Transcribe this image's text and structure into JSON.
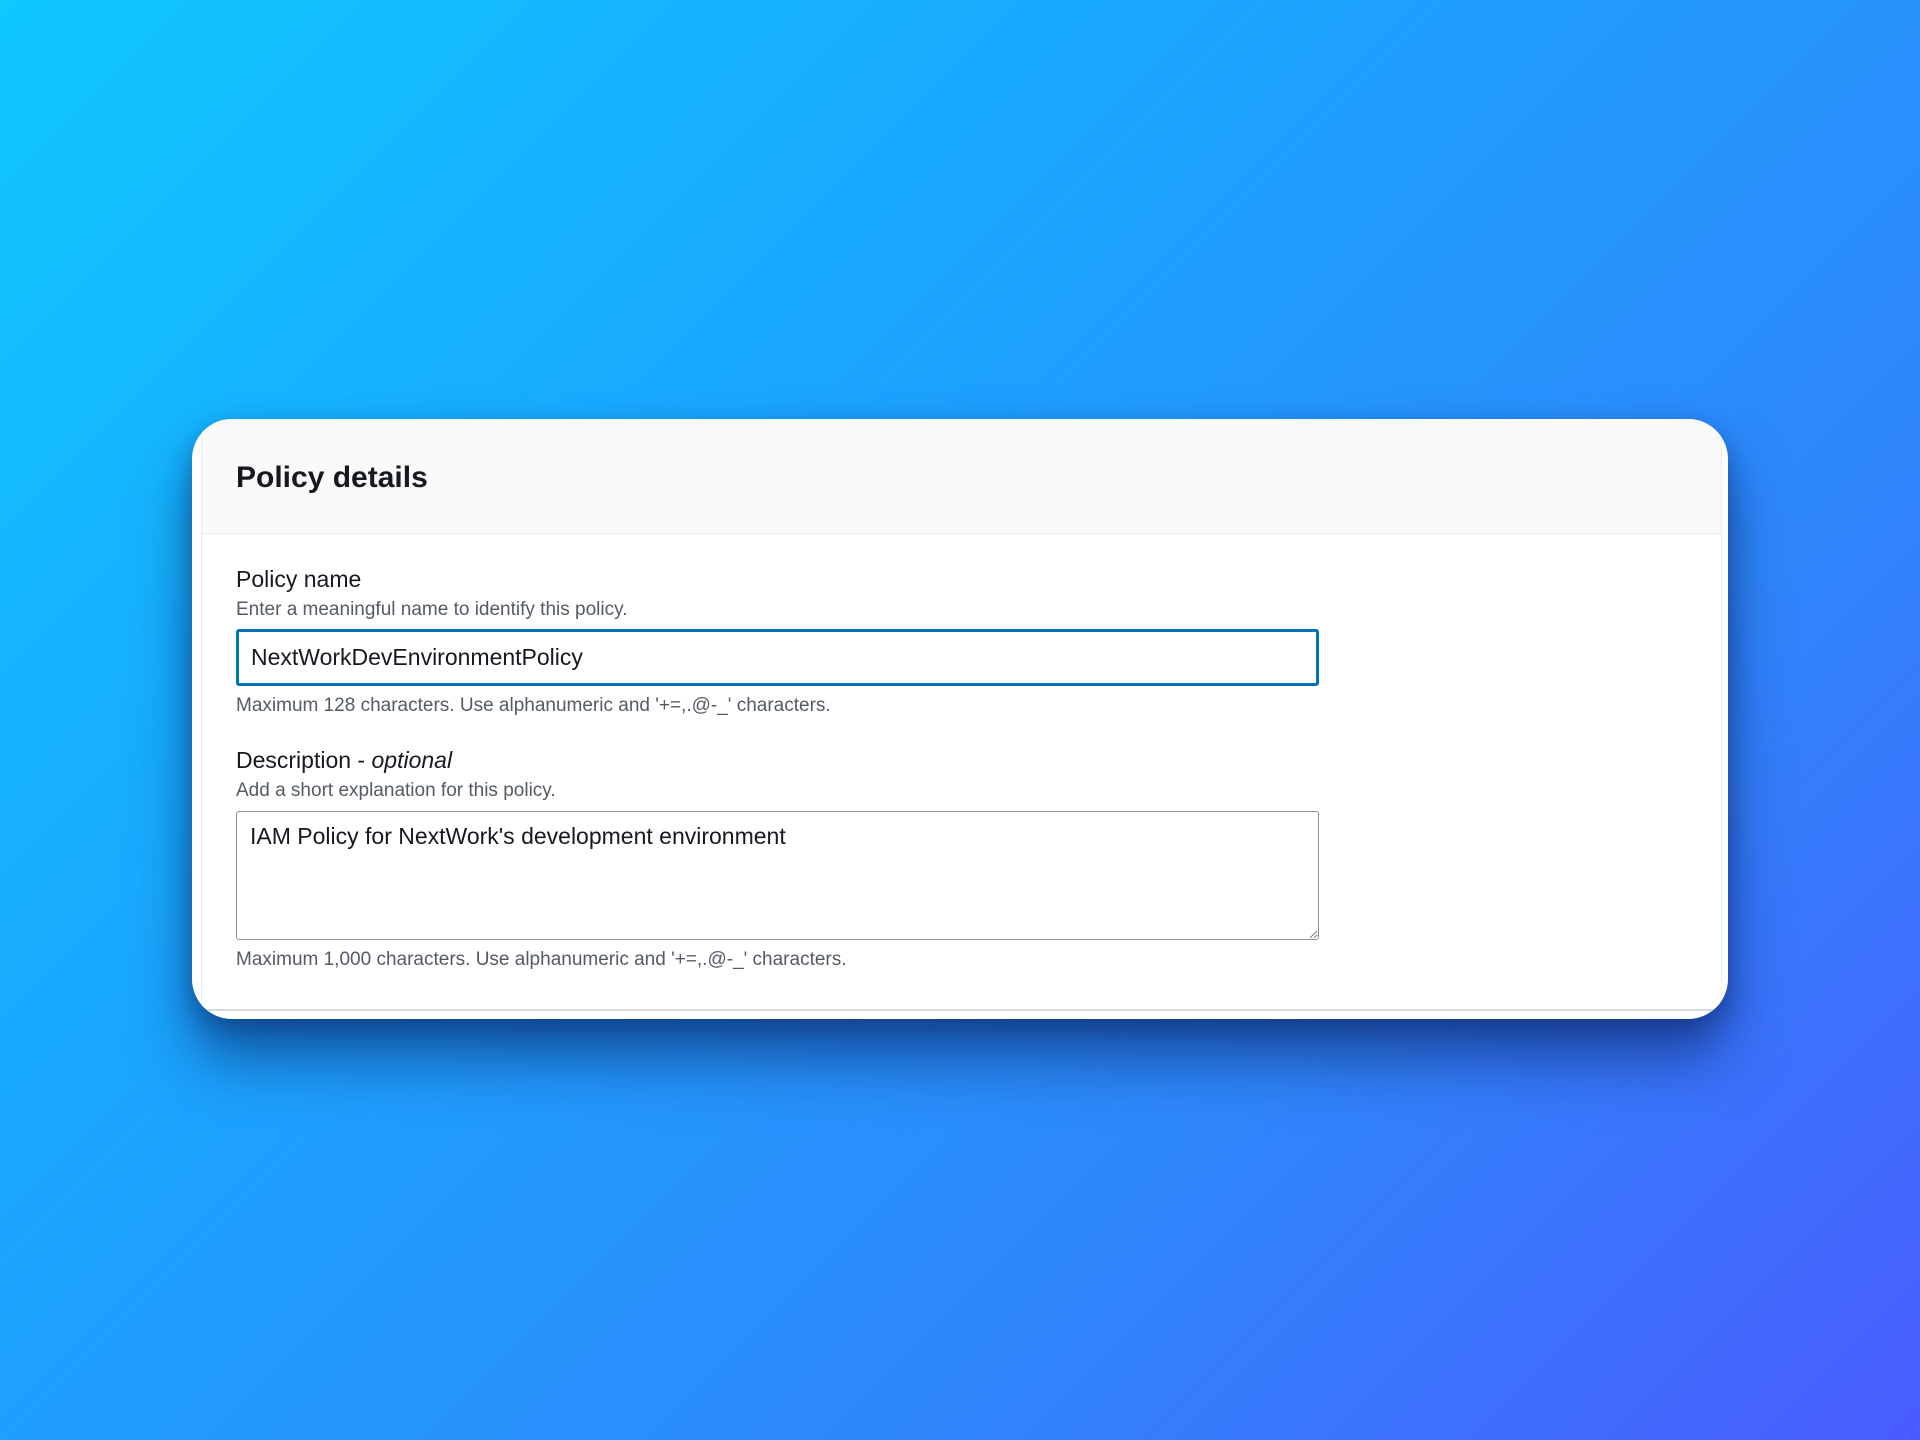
{
  "panel": {
    "title": "Policy details"
  },
  "policy_name": {
    "label": "Policy name",
    "description": "Enter a meaningful name to identify this policy.",
    "value": "NextWorkDevEnvironmentPolicy",
    "constraint": "Maximum 128 characters. Use alphanumeric and '+=,.@-_' characters."
  },
  "description_field": {
    "label": "Description - ",
    "label_optional": "optional",
    "description": "Add a short explanation for this policy.",
    "value": "IAM Policy for NextWork's development environment",
    "constraint": "Maximum 1,000 characters. Use alphanumeric and '+=,.@-_' characters."
  }
}
